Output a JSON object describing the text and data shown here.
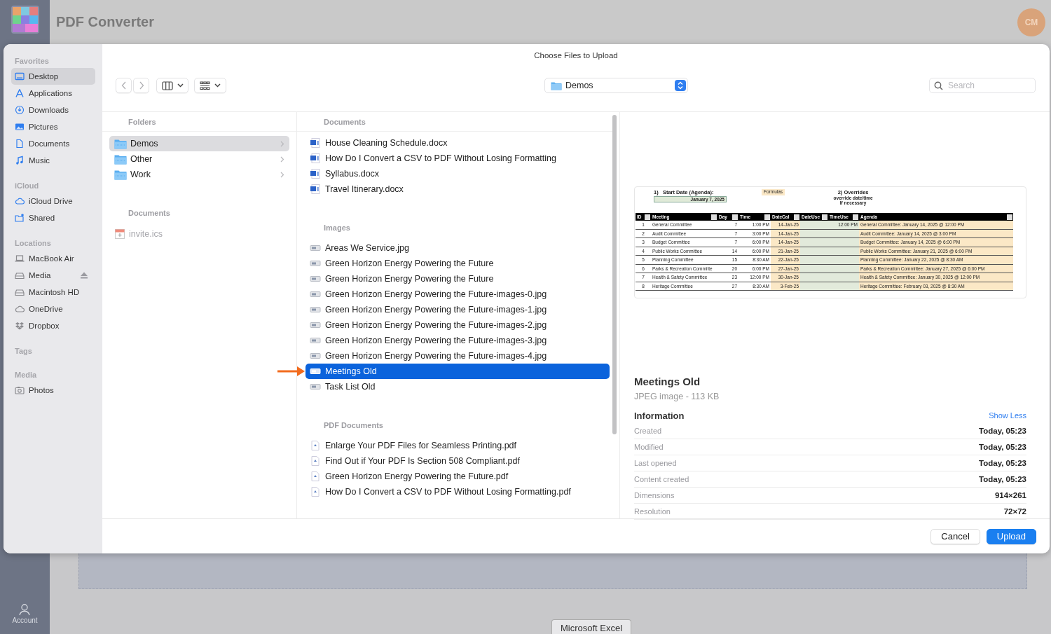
{
  "app": {
    "title": "PDF Converter",
    "avatar": "CM",
    "account": "Account",
    "bottom_tab": "Microsoft Excel"
  },
  "dialog": {
    "title": "Choose Files to Upload",
    "location": "Demos",
    "search": {
      "placeholder": "Search"
    },
    "sidebar": [
      {
        "heading": "Favorites",
        "items": [
          {
            "label": "Desktop",
            "kind": "desktop",
            "selected": true
          },
          {
            "label": "Applications",
            "kind": "apps",
            "selected": false
          },
          {
            "label": "Downloads",
            "kind": "download",
            "selected": false
          },
          {
            "label": "Pictures",
            "kind": "pictures",
            "selected": false
          },
          {
            "label": "Documents",
            "kind": "document",
            "selected": false
          },
          {
            "label": "Music",
            "kind": "music",
            "selected": false
          }
        ]
      },
      {
        "heading": "iCloud",
        "items": [
          {
            "label": "iCloud Drive",
            "kind": "cloud",
            "selected": false
          },
          {
            "label": "Shared",
            "kind": "shared",
            "selected": false
          }
        ]
      },
      {
        "heading": "Locations",
        "items": [
          {
            "label": "MacBook Air",
            "kind": "laptop",
            "selected": false
          },
          {
            "label": "Media",
            "kind": "drive",
            "selected": false,
            "ejectable": true
          },
          {
            "label": "Macintosh HD",
            "kind": "drive",
            "selected": false
          },
          {
            "label": "OneDrive",
            "kind": "storage-cloud",
            "selected": false
          },
          {
            "label": "Dropbox",
            "kind": "dropbox",
            "selected": false
          }
        ]
      },
      {
        "heading": "Tags"
      },
      {
        "heading": "Media",
        "items": [
          {
            "label": "Photos",
            "kind": "camera",
            "selected": false
          }
        ]
      }
    ],
    "folders": {
      "heading": "Folders",
      "items": [
        {
          "label": "Demos",
          "selected": true
        },
        {
          "label": "Other",
          "selected": false
        },
        {
          "label": "Work",
          "selected": false
        }
      ],
      "documents_heading": "Documents",
      "documents": [
        {
          "label": "invite.ics",
          "disabled": true
        }
      ]
    },
    "files": [
      {
        "heading": "Documents",
        "items": [
          {
            "label": "House Cleaning Schedule.docx",
            "kind": "word",
            "selected": false
          },
          {
            "label": "How Do I Convert a CSV to PDF Without Losing Formatting",
            "kind": "word",
            "selected": false
          },
          {
            "label": "Syllabus.docx",
            "kind": "word",
            "selected": false
          },
          {
            "label": "Travel Itinerary.docx",
            "kind": "word",
            "selected": false
          }
        ]
      },
      {
        "heading": "Images",
        "items": [
          {
            "label": "Areas We Service.jpg",
            "kind": "image",
            "selected": false
          },
          {
            "label": "Green Horizon Energy Powering the Future",
            "kind": "image",
            "selected": false
          },
          {
            "label": "Green Horizon Energy Powering the Future",
            "kind": "image",
            "selected": false
          },
          {
            "label": "Green Horizon Energy Powering the Future-images-0.jpg",
            "kind": "image",
            "selected": false
          },
          {
            "label": "Green Horizon Energy Powering the Future-images-1.jpg",
            "kind": "image",
            "selected": false
          },
          {
            "label": "Green Horizon Energy Powering the Future-images-2.jpg",
            "kind": "image",
            "selected": false
          },
          {
            "label": "Green Horizon Energy Powering the Future-images-3.jpg",
            "kind": "image",
            "selected": false
          },
          {
            "label": "Green Horizon Energy Powering the Future-images-4.jpg",
            "kind": "image",
            "selected": false
          },
          {
            "label": "Meetings Old",
            "kind": "image",
            "selected": true
          },
          {
            "label": "Task List Old",
            "kind": "image",
            "selected": false
          }
        ]
      },
      {
        "heading": "PDF Documents",
        "items": [
          {
            "label": "Enlarge Your PDF Files for Seamless Printing.pdf",
            "kind": "pdf",
            "selected": false
          },
          {
            "label": "Find Out if Your PDF Is Section 508 Compliant.pdf",
            "kind": "pdf",
            "selected": false
          },
          {
            "label": "Green Horizon Energy Powering the Future.pdf",
            "kind": "pdf",
            "selected": false
          },
          {
            "label": "How Do I Convert a CSV to PDF Without Losing Formatting.pdf",
            "kind": "pdf",
            "selected": false
          }
        ]
      }
    ],
    "preview": {
      "sheet": {
        "start_label": "1)   Start Date (Agenda):",
        "start_date": "January 7, 2025",
        "formulas": "Formulas",
        "overrides": "2) Overrides",
        "override_note": "override date/time",
        "if_necessary": "If necessary",
        "columns": [
          "ID",
          "Meeting",
          "Day",
          "Time",
          "DateCal",
          "DateUse",
          "TimeUse",
          "Agenda"
        ],
        "rows": [
          {
            "id": "1",
            "meeting": "General Committee",
            "day": "7",
            "time": "1:00 PM",
            "date_calc": "14-Jan-25",
            "time_use": "12:00 PM",
            "agenda": "General Committee: January 14, 2025 @ 12:00 PM"
          },
          {
            "id": "2",
            "meeting": "Audit Committee",
            "day": "7",
            "time": "3:00 PM",
            "date_calc": "14-Jan-25",
            "agenda": "Audit Committee: January 14, 2025 @ 3:00 PM"
          },
          {
            "id": "3",
            "meeting": "Budget Committee",
            "day": "7",
            "time": "6:00 PM",
            "date_calc": "14-Jan-25",
            "agenda": "Budget Committee: January 14, 2025 @ 6:00 PM"
          },
          {
            "id": "4",
            "meeting": "Public Works Committee",
            "day": "14",
            "time": "6:00 PM",
            "date_calc": "21-Jan-25",
            "agenda": "Public Works Committee: January 21, 2025 @ 6:00 PM"
          },
          {
            "id": "5",
            "meeting": "Planning Committee",
            "day": "15",
            "time": "8:30 AM",
            "date_calc": "22-Jan-25",
            "agenda": "Planning Committee: January 22, 2025 @ 8:30 AM"
          },
          {
            "id": "6",
            "meeting": "Parks & Recreation Committe",
            "day": "20",
            "time": "6:00 PM",
            "date_calc": "27-Jan-25",
            "agenda": "Parks & Recreation Committee: January 27, 2025 @ 6:00 PM"
          },
          {
            "id": "7",
            "meeting": "Health & Safety Committee",
            "day": "23",
            "time": "12:00 PM",
            "date_calc": "30-Jan-25",
            "agenda": "Health & Safety Committee: January 30, 2025 @ 12:00 PM"
          },
          {
            "id": "8",
            "meeting": "Heritage Committee",
            "day": "27",
            "time": "8:30 AM",
            "date_calc": "3-Feb-25",
            "agenda": "Heritage Committee: February 03, 2025 @ 8:30 AM"
          }
        ]
      },
      "name": "Meetings Old",
      "subtitle": "JPEG image - 113 KB",
      "info_heading": "Information",
      "toggle": "Show Less",
      "info": [
        {
          "label": "Created",
          "value": "Today, 05:23"
        },
        {
          "label": "Modified",
          "value": "Today, 05:23"
        },
        {
          "label": "Last opened",
          "value": "Today, 05:23"
        },
        {
          "label": "Content created",
          "value": "Today, 05:23"
        },
        {
          "label": "Dimensions",
          "value": "914×261"
        },
        {
          "label": "Resolution",
          "value": "72×72"
        }
      ]
    },
    "buttons": [
      {
        "label": "Cancel",
        "primary": false
      },
      {
        "label": "Upload",
        "primary": true
      }
    ]
  }
}
